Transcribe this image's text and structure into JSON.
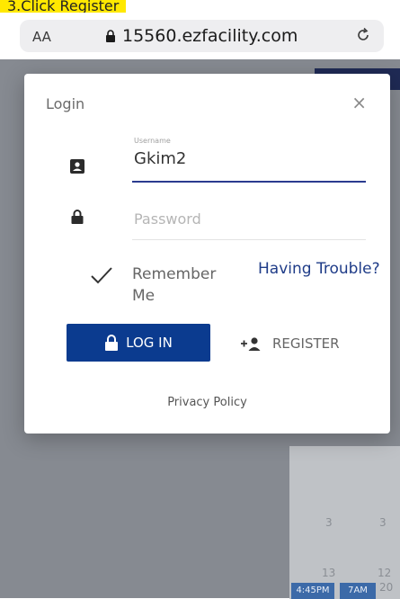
{
  "banner": {
    "text": "3.Click Register"
  },
  "browser": {
    "text_size_label": "AA",
    "url": "15560.ezfacility.com"
  },
  "background": {
    "calendar_numbers": [
      "3",
      "13",
      "12",
      "20"
    ],
    "chips": [
      "4:45PM",
      "7AM"
    ]
  },
  "dialog": {
    "title": "Login",
    "close_label": "×",
    "username": {
      "caption": "Username",
      "value": "Gkim2"
    },
    "password": {
      "placeholder": "Password",
      "value": ""
    },
    "remember_label": "Remember Me",
    "trouble_link": "Having Trouble?",
    "login_button": "LOG IN",
    "register_button": "REGISTER",
    "privacy_link": "Privacy Policy"
  },
  "colors": {
    "primary": "#0b3b8f",
    "link": "#1f3c88",
    "highlight": "#ffe800"
  }
}
